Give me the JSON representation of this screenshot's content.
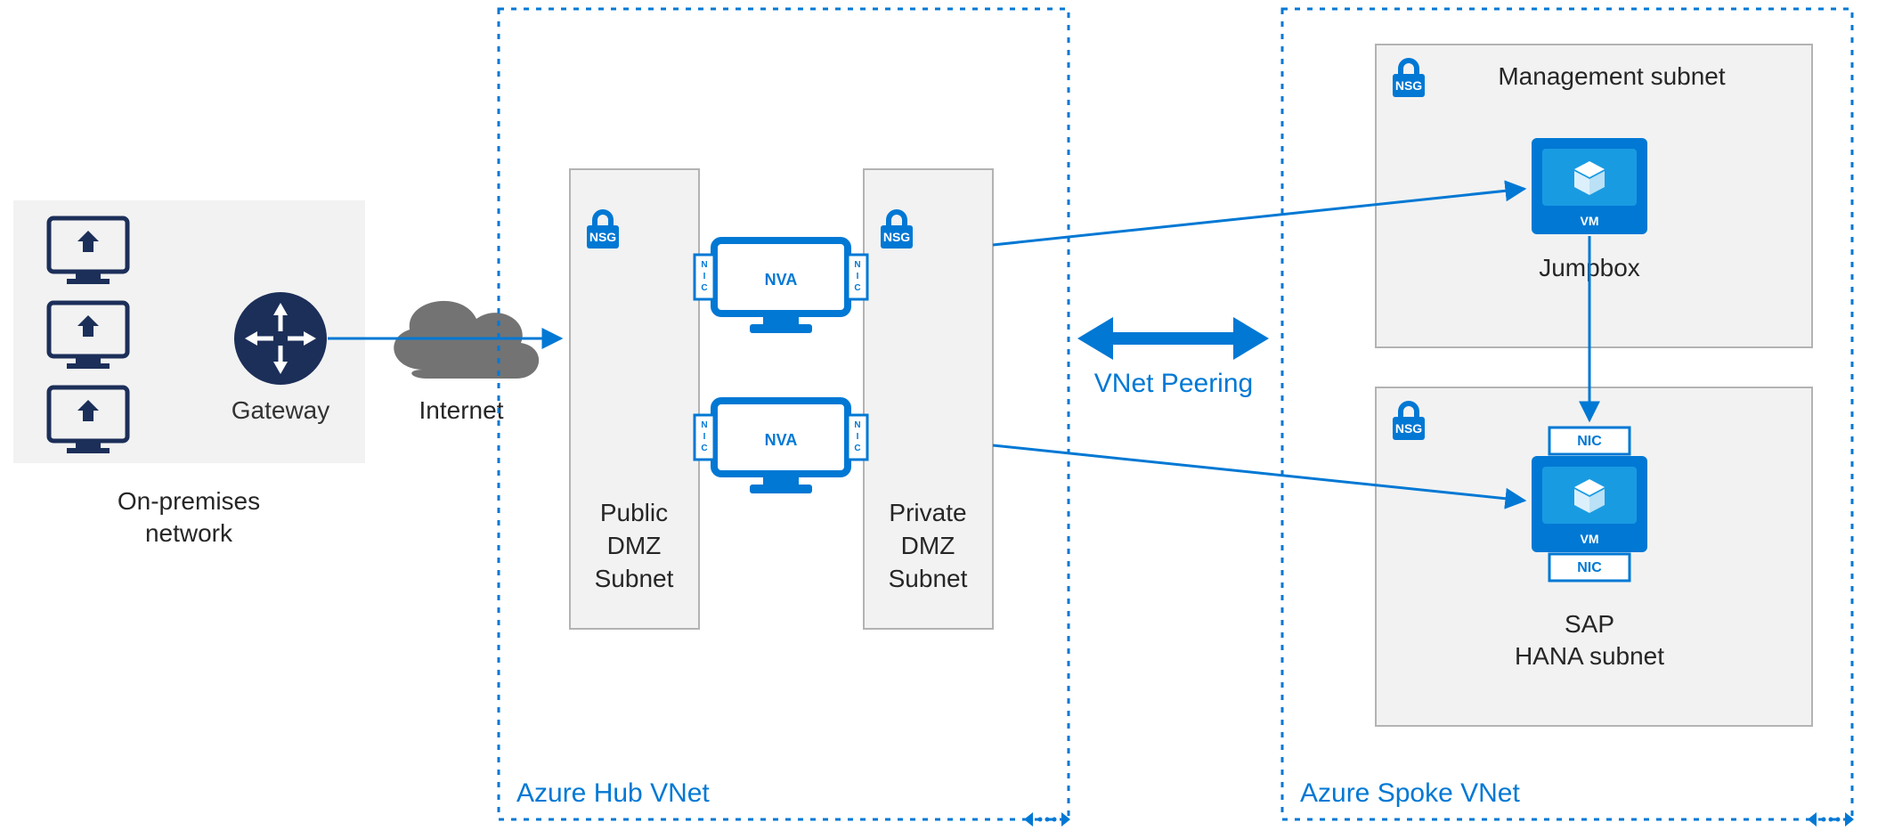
{
  "onprem": {
    "title_l1": "On-premises",
    "title_l2": "network"
  },
  "gateway": {
    "label": "Gateway"
  },
  "internet": {
    "label": "Internet"
  },
  "hub": {
    "title": "Azure Hub VNet",
    "public_dmz_l1": "Public",
    "public_dmz_l2": "DMZ",
    "public_dmz_l3": "Subnet",
    "private_dmz_l1": "Private",
    "private_dmz_l2": "DMZ",
    "private_dmz_l3": "Subnet",
    "nsg": "NSG",
    "nva": "NVA",
    "nic": "NIC"
  },
  "peering": {
    "label": "VNet Peering"
  },
  "spoke": {
    "title": "Azure Spoke VNet",
    "mgmt_title": "Management subnet",
    "jumpbox": "Jumpbox",
    "sap_l1": "SAP",
    "sap_l2": "HANA subnet",
    "nsg": "NSG",
    "vm": "VM",
    "nic": "NIC"
  },
  "colors": {
    "azureBlue": "#0078D4",
    "navy": "#1C2F59",
    "grayBox": "#F2F2F2",
    "grayBorder": "#B3B3B3",
    "cloudGray": "#737373"
  }
}
